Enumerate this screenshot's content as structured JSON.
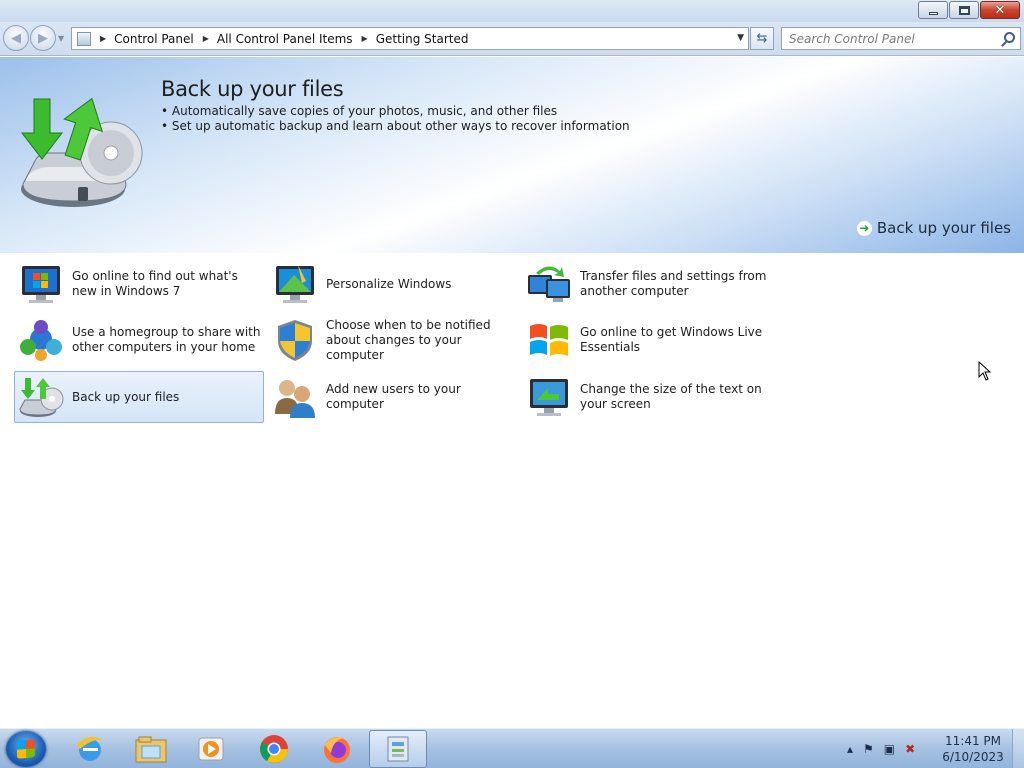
{
  "window": {
    "minimize_label": "minimize",
    "maximize_label": "restore",
    "close_label": "close"
  },
  "nav": {
    "breadcrumb": [
      "Control Panel",
      "All Control Panel Items",
      "Getting Started"
    ],
    "search_placeholder": "Search Control Panel"
  },
  "banner": {
    "title": "Back up your files",
    "bullets": [
      "Automatically save copies of your photos, music, and other files",
      "Set up automatic backup and learn about other ways to recover information"
    ],
    "action_link": "Back up your files"
  },
  "tasks": [
    {
      "label": "Go online to find out what's new in Windows 7",
      "icon": "monitor-windows-icon"
    },
    {
      "label": "Personalize Windows",
      "icon": "personalize-icon"
    },
    {
      "label": "Transfer files and settings from another computer",
      "icon": "easy-transfer-icon"
    },
    {
      "label": "Use a homegroup to share with other computers in your home",
      "icon": "homegroup-icon"
    },
    {
      "label": "Choose when to be notified about changes to your computer",
      "icon": "uac-shield-icon"
    },
    {
      "label": "Go online to get Windows Live Essentials",
      "icon": "windows-flag-icon"
    },
    {
      "label": "Back up your files",
      "icon": "backup-icon",
      "selected": true
    },
    {
      "label": "Add new users to your computer",
      "icon": "users-icon"
    },
    {
      "label": "Change the size of the text on your screen",
      "icon": "display-icon"
    }
  ],
  "taskbar": {
    "items": [
      "internet-explorer-icon",
      "windows-explorer-icon",
      "media-player-icon",
      "chrome-icon",
      "firefox-icon",
      "control-panel-icon"
    ],
    "active_item": "control-panel-icon",
    "clock_time": "11:41 PM",
    "clock_date": "6/10/2023"
  }
}
